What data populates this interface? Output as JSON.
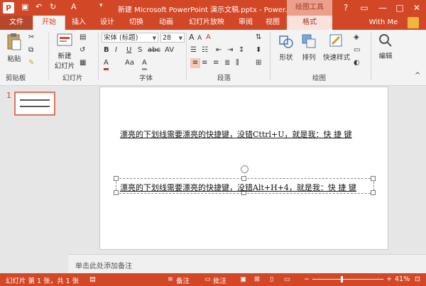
{
  "title_bar": {
    "title": "新建 Microsoft PowerPoint 演示文稿.pptx - Power...",
    "context_tab": "绘图工具",
    "buttons": {
      "help": "?",
      "restore": "▭",
      "minimize": "—",
      "maximize": "□",
      "close": "✕"
    }
  },
  "tabs": [
    {
      "label": "文件"
    },
    {
      "label": "开始"
    },
    {
      "label": "插入"
    },
    {
      "label": "设计"
    },
    {
      "label": "切换"
    },
    {
      "label": "动画"
    },
    {
      "label": "幻灯片放映"
    },
    {
      "label": "审阅"
    },
    {
      "label": "视图"
    },
    {
      "label": "格式"
    }
  ],
  "account": "With Me",
  "ribbon": {
    "clipboard": {
      "paste": "粘贴",
      "group": "剪贴板"
    },
    "slides": {
      "new_slide_line1": "新建",
      "new_slide_line2": "幻灯片",
      "group": "幻灯片"
    },
    "font": {
      "name": "宋体 (标题)",
      "size": "28",
      "group": "字体",
      "grow": "A",
      "shrink": "A",
      "clear": "A",
      "bold": "B",
      "italic": "I",
      "underline": "U",
      "strike": "S",
      "abc": "abc",
      "spacing": "AV",
      "color_a": "A",
      "aa": "Aa",
      "highlight": "A"
    },
    "paragraph": {
      "group": "段落"
    },
    "drawing": {
      "shapes": "形状",
      "arrange": "排列",
      "quick_styles": "快速样式",
      "group": "绘图"
    },
    "editing": {
      "label": "编辑"
    }
  },
  "thumbnail": {
    "number": "1"
  },
  "slide": {
    "line1": "漂亮的下划线需要漂亮的快捷键，没错Cttrl+U，就是我：快 捷 键",
    "line2": "漂亮的下划线需要漂亮的快捷键，没错Alt+H+4，就是我：快 捷 键"
  },
  "notes_placeholder": "单击此处添加备注",
  "status_bar": {
    "slide_info": "幻灯片 第 1 张，共 1 张",
    "notes": "备注",
    "comments": "批注",
    "zoom": "41%",
    "zoom_level": 0.41
  },
  "colors": {
    "accent": "#d24726",
    "context_tab_bg": "#eaa08c"
  }
}
